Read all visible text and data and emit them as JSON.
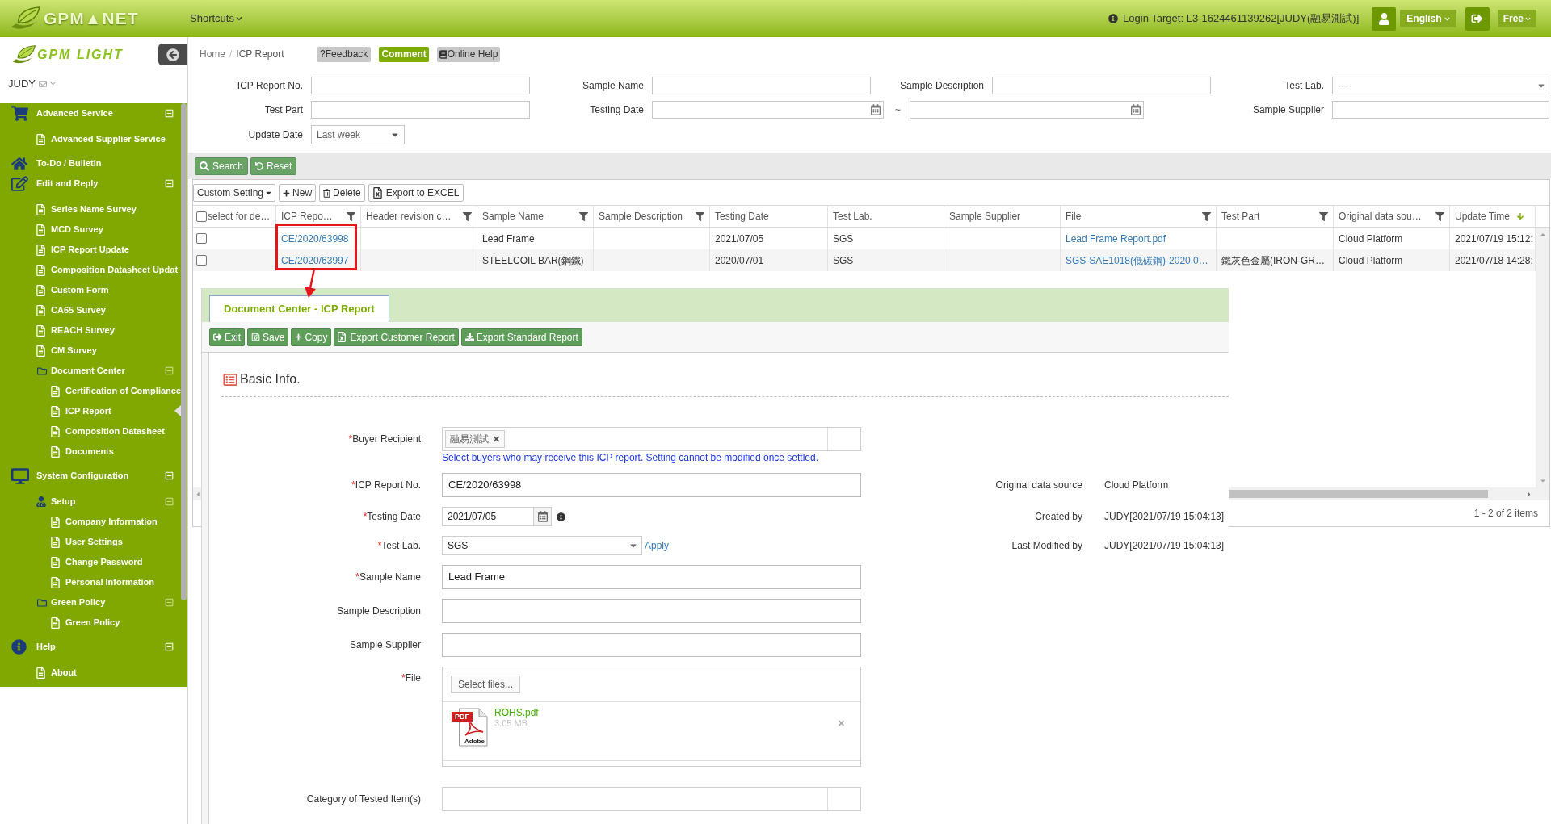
{
  "header": {
    "logo": "GPM▲NET",
    "shortcuts": "Shortcuts",
    "login_target": "Login Target: L3-1624461139262[JUDY(融易測試)]",
    "language": "English",
    "plan": "Free"
  },
  "sidebar": {
    "logo": "GPM LIGHT",
    "user": "JUDY",
    "items": [
      {
        "label": "Advanced Service",
        "expanded": true,
        "children": [
          {
            "label": "Advanced Supplier Service",
            "selected": false
          }
        ]
      },
      {
        "label": "To-Do / Bulletin",
        "selected": false
      },
      {
        "label": "Edit and Reply",
        "expanded": true,
        "children": [
          {
            "label": "Series Name Survey",
            "selected": false
          },
          {
            "label": "MCD Survey",
            "selected": false
          },
          {
            "label": "ICP Report Update",
            "selected": false
          },
          {
            "label": "Composition Datasheet Updat",
            "selected": false
          },
          {
            "label": "Custom Form",
            "selected": false
          },
          {
            "label": "CA65 Survey",
            "selected": false
          },
          {
            "label": "REACH Survey",
            "selected": false
          },
          {
            "label": "CM Survey",
            "selected": false
          },
          {
            "label": "Document Center",
            "expanded": true,
            "children": [
              {
                "label": "Certification of Compliance",
                "selected": false
              },
              {
                "label": "ICP Report",
                "selected": true
              },
              {
                "label": "Composition Datasheet",
                "selected": false
              },
              {
                "label": "Documents",
                "selected": false
              }
            ]
          }
        ]
      },
      {
        "label": "System Configuration",
        "expanded": true,
        "children": [
          {
            "label": "Setup",
            "expanded": true,
            "children": [
              {
                "label": "Company Information",
                "selected": false
              },
              {
                "label": "User Settings",
                "selected": false
              },
              {
                "label": "Change Password",
                "selected": false
              },
              {
                "label": "Personal Information",
                "selected": false
              }
            ]
          },
          {
            "label": "Green Policy",
            "expanded": true,
            "children": [
              {
                "label": "Green Policy",
                "selected": false
              }
            ]
          }
        ]
      },
      {
        "label": "Help",
        "expanded": true,
        "children": [
          {
            "label": "About",
            "selected": false
          }
        ]
      }
    ]
  },
  "breadcrumb": {
    "items": [
      "Home",
      "ICP Report"
    ],
    "separator": "/"
  },
  "page_actions": [
    {
      "label": "?Feedback",
      "kind": "plain"
    },
    {
      "label": "Comment",
      "kind": "accent"
    },
    {
      "label": "Online Help",
      "kind": "help"
    }
  ],
  "search_form": {
    "rows": [
      [
        {
          "label": "ICP Report No.",
          "kind": "text"
        },
        {
          "label": "Sample Name",
          "kind": "text"
        },
        {
          "label": "Sample Description",
          "kind": "text"
        },
        {
          "label": "Test Lab.",
          "kind": "select",
          "value": "---"
        }
      ],
      [
        {
          "label": "Test Part",
          "kind": "text"
        },
        {
          "label": "Testing Date",
          "kind": "date_range",
          "separator": "~",
          "colspan": 2
        },
        {
          "label": "Sample Supplier",
          "kind": "text"
        }
      ],
      [
        {
          "label": "Update Date",
          "kind": "dropdown",
          "value": "Last week"
        }
      ]
    ],
    "buttons": [
      {
        "label": "Search",
        "kind": "search"
      },
      {
        "label": "Reset",
        "kind": "reset"
      }
    ]
  },
  "grid": {
    "toolbar": [
      {
        "label": "Custom Setting",
        "kind": "dropdown"
      },
      {
        "label": "New",
        "kind": "add"
      },
      {
        "label": "Delete",
        "kind": "delete"
      },
      {
        "label": "Export to EXCEL",
        "kind": "excel"
      }
    ],
    "select_all": {
      "label": "select for de…",
      "checked": false
    },
    "columns": [
      {
        "label": "ICP Repo…",
        "filter": true,
        "sorted": false
      },
      {
        "label": "Header revision c…",
        "filter": true,
        "sorted": false
      },
      {
        "label": "Sample Name",
        "filter": true,
        "sorted": false
      },
      {
        "label": "Sample Description",
        "filter": true,
        "sorted": false
      },
      {
        "label": "Testing Date",
        "filter": false,
        "sorted": false
      },
      {
        "label": "Test Lab.",
        "filter": false,
        "sorted": false
      },
      {
        "label": "Sample Supplier",
        "filter": false,
        "sorted": false
      },
      {
        "label": "File",
        "filter": true,
        "sorted": false
      },
      {
        "label": "Test Part",
        "filter": true,
        "sorted": false
      },
      {
        "label": "Original data sou…",
        "filter": true,
        "sorted": false
      },
      {
        "label": "Update Time",
        "filter": false,
        "sorted": true
      }
    ],
    "rows": [
      {
        "checked": false,
        "cells": [
          {
            "text": "CE/2020/63998",
            "link": true
          },
          null,
          {
            "text": "Lead Frame",
            "link": false
          },
          null,
          {
            "text": "2021/07/05",
            "link": false
          },
          {
            "text": "SGS",
            "link": false
          },
          null,
          {
            "text": "Lead Frame Report.pdf",
            "link": true
          },
          null,
          {
            "text": "Cloud Platform",
            "link": false
          },
          {
            "text": "2021/07/19 15:12:",
            "link": false
          }
        ]
      },
      {
        "checked": false,
        "cells": [
          {
            "text": "CE/2020/63997",
            "link": true
          },
          null,
          {
            "text": "STEELCOIL BAR(鋼鐵)",
            "link": false
          },
          null,
          {
            "text": "2020/07/01",
            "link": false
          },
          {
            "text": "SGS",
            "link": false
          },
          null,
          {
            "text": "SGS-SAE1018(低碳鋼)-2020.0…",
            "link": true
          },
          {
            "text": "鐵灰色金屬(IRON-GR…",
            "link": false
          },
          {
            "text": "Cloud Platform",
            "link": false
          },
          {
            "text": "2021/07/18 14:28:",
            "link": false
          }
        ]
      }
    ],
    "pager": "1 - 2 of 2 items"
  },
  "document_window": {
    "tabs": [
      {
        "label": "Document Center - ICP Report",
        "selected": true
      }
    ],
    "toolbar": [
      {
        "label": "Exit",
        "kind": "exit"
      },
      {
        "label": "Save",
        "kind": "save"
      },
      {
        "label": "Copy",
        "kind": "copy"
      },
      {
        "label": "Export Customer Report",
        "kind": "excel"
      },
      {
        "label": "Export Standard Report",
        "kind": "download"
      }
    ],
    "section_title": "Basic Info.",
    "fields": [
      {
        "label": "Buyer Recipient",
        "required_mark": "*",
        "kind": "multiselect",
        "tags": [
          "融易測試"
        ],
        "help": "Select buyers who may receive this ICP report. Setting cannot be modified once settled."
      },
      {
        "label": "ICP Report No.",
        "required_mark": "*",
        "kind": "text",
        "value": "CE/2020/63998"
      },
      {
        "label": "Testing Date",
        "required_mark": "*",
        "kind": "date",
        "value": "2021/07/05"
      },
      {
        "label": "Test Lab.",
        "required_mark": "*",
        "kind": "select",
        "value": "SGS",
        "link": "Apply"
      },
      {
        "label": "Sample Name",
        "required_mark": "*",
        "kind": "text",
        "value": "Lead Frame"
      },
      {
        "label": "Sample Description",
        "kind": "text"
      },
      {
        "label": "Sample Supplier",
        "kind": "text"
      },
      {
        "label": "File",
        "required_mark": "*",
        "kind": "upload",
        "button": "Select files...",
        "files": [
          {
            "name": "ROHS.pdf",
            "size": "3.05 MB",
            "icon_labels": [
              "PDF",
              "Adobe"
            ]
          }
        ]
      },
      {
        "label": "Category of Tested Item(s)",
        "kind": "multiselect"
      }
    ],
    "info": [
      {
        "label": "Original data source",
        "value": "Cloud Platform"
      },
      {
        "label": "Created by",
        "value": "JUDY[2021/07/19 15:04:13]"
      },
      {
        "label": "Last Modified by",
        "value": "JUDY[2021/07/19 15:04:13]"
      }
    ]
  }
}
